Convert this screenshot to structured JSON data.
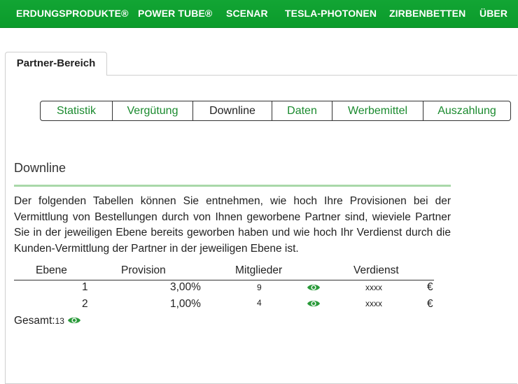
{
  "topnav": {
    "items": [
      {
        "label": "ERDUNGSPRODUKTE®"
      },
      {
        "label": "POWER TUBE®"
      },
      {
        "label": "SCENAR"
      },
      {
        "label": "TESLA-PHOTONEN"
      },
      {
        "label": "ZIRBENBETTEN"
      },
      {
        "label": "ÜBER"
      }
    ]
  },
  "tab": {
    "label": "Partner-Bereich"
  },
  "subnav": {
    "items": [
      {
        "label": "Statistik"
      },
      {
        "label": "Vergütung"
      },
      {
        "label": "Downline",
        "active": true
      },
      {
        "label": "Daten"
      },
      {
        "label": "Werbemittel"
      },
      {
        "label": "Auszahlung"
      }
    ]
  },
  "main": {
    "title": "Downline",
    "intro": "Der folgenden Tabellen können Sie entnehmen, wie hoch Ihre Provisionen bei der Vermittlung von Bestellungen durch von Ihnen geworbene Partner sind, wieviele Partner Sie in der jeweiligen Ebene bereits geworben haben und wie hoch Ihr Verdienst durch die Kunden-Vermittlung der Partner in der jeweiligen Ebene ist."
  },
  "table": {
    "headers": {
      "ebene": "Ebene",
      "provision": "Provision",
      "mitglieder": "Mitglieder",
      "verdienst": "Verdienst"
    },
    "rows": [
      {
        "ebene": "1",
        "provision": "3,00%",
        "mitglieder": "9",
        "verdienst": "xxxx",
        "currency": "€"
      },
      {
        "ebene": "2",
        "provision": "1,00%",
        "mitglieder": "4",
        "verdienst": "xxxx",
        "currency": "€"
      }
    ],
    "total_label": "Gesamt:",
    "total_count": "13"
  },
  "colors": {
    "brand": "#0b9b2b",
    "link": "#1a8a2e",
    "rule": "#a9d8a9"
  },
  "icons": {
    "view": "eye-icon"
  }
}
